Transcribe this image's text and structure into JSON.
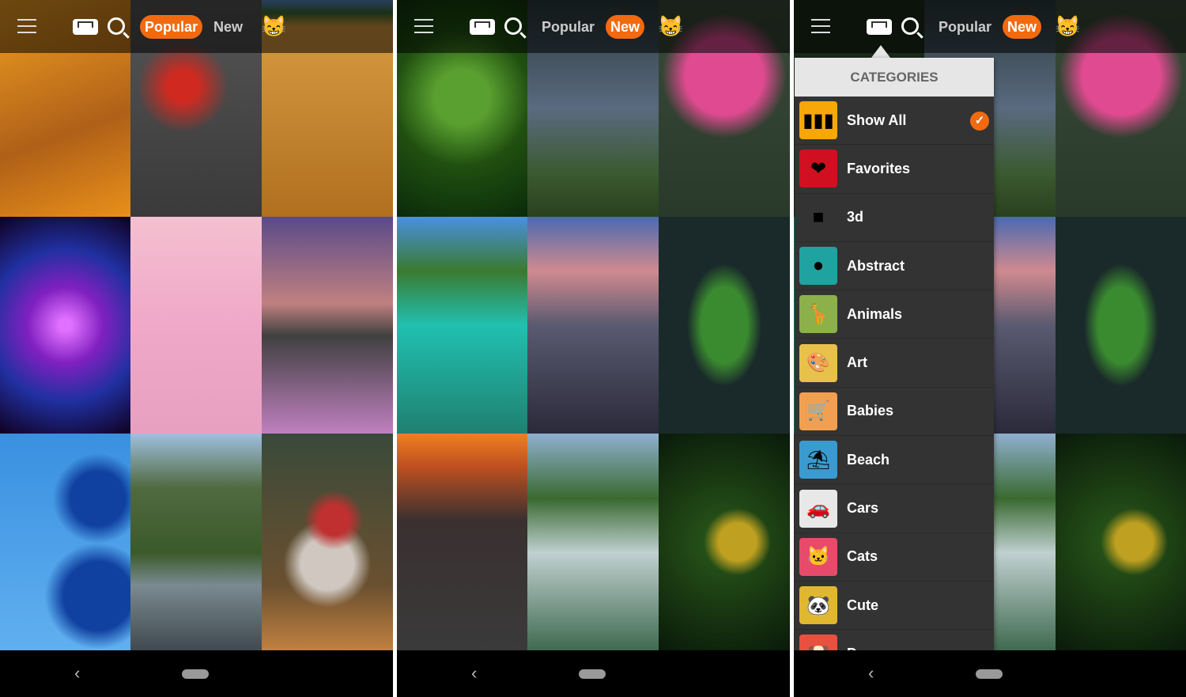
{
  "header": {
    "tabs": [
      {
        "label": "Popular"
      },
      {
        "label": "New"
      }
    ],
    "mascot": "😸"
  },
  "screens": [
    {
      "active_tab": "Popular"
    },
    {
      "active_tab": "New"
    },
    {
      "active_tab": "New"
    }
  ],
  "categories": {
    "title": "CATEGORIES",
    "selected": "Show All",
    "items": [
      {
        "label": "Show All",
        "icon": "▮▮▮",
        "color": "#f7a70a"
      },
      {
        "label": "Favorites",
        "icon": "❤",
        "color": "#d01020"
      },
      {
        "label": "3d",
        "icon": "■",
        "color": "#333333"
      },
      {
        "label": "Abstract",
        "icon": "●",
        "color": "#1fa3a0"
      },
      {
        "label": "Animals",
        "icon": "🦒",
        "color": "#8cb04a"
      },
      {
        "label": "Art",
        "icon": "🎨",
        "color": "#e8c14a"
      },
      {
        "label": "Babies",
        "icon": "🛒",
        "color": "#f0a050"
      },
      {
        "label": "Beach",
        "icon": "⛱",
        "color": "#3a9bd0"
      },
      {
        "label": "Cars",
        "icon": "🚗",
        "color": "#e8e8e8"
      },
      {
        "label": "Cats",
        "icon": "🐱",
        "color": "#e84a6a"
      },
      {
        "label": "Cute",
        "icon": "🐼",
        "color": "#e0b830"
      },
      {
        "label": "D",
        "icon": "🐶",
        "color": "#e85040"
      }
    ]
  },
  "accent": "#f26a10"
}
